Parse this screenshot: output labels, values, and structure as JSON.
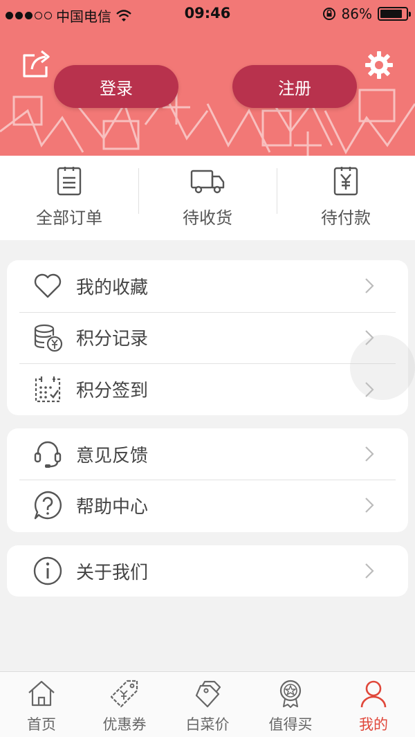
{
  "status_bar": {
    "carrier": "中国电信",
    "time": "09:46",
    "battery": "86%",
    "battery_level": 0.86
  },
  "header": {
    "login_label": "登录",
    "register_label": "注册"
  },
  "orders": [
    {
      "label": "全部订单",
      "icon": "order-list-icon"
    },
    {
      "label": "待收货",
      "icon": "truck-icon"
    },
    {
      "label": "待付款",
      "icon": "payment-icon"
    }
  ],
  "menu_group_1": [
    {
      "label": "我的收藏",
      "icon": "heart-icon"
    },
    {
      "label": "积分记录",
      "icon": "coins-icon"
    },
    {
      "label": "积分签到",
      "icon": "calendar-check-icon"
    }
  ],
  "menu_group_2": [
    {
      "label": "意见反馈",
      "icon": "headset-icon"
    },
    {
      "label": "帮助中心",
      "icon": "help-icon"
    }
  ],
  "menu_group_3": [
    {
      "label": "关于我们",
      "icon": "info-icon"
    }
  ],
  "tabbar": [
    {
      "label": "首页",
      "icon": "home-icon"
    },
    {
      "label": "优惠券",
      "icon": "coupon-icon"
    },
    {
      "label": "白菜价",
      "icon": "price-tag-icon"
    },
    {
      "label": "值得买",
      "icon": "badge-icon"
    },
    {
      "label": "我的",
      "icon": "user-icon",
      "active": true
    }
  ],
  "colors": {
    "header_bg": "#f27876",
    "auth_button": "#b8324d",
    "active_tab": "#e0473a"
  }
}
